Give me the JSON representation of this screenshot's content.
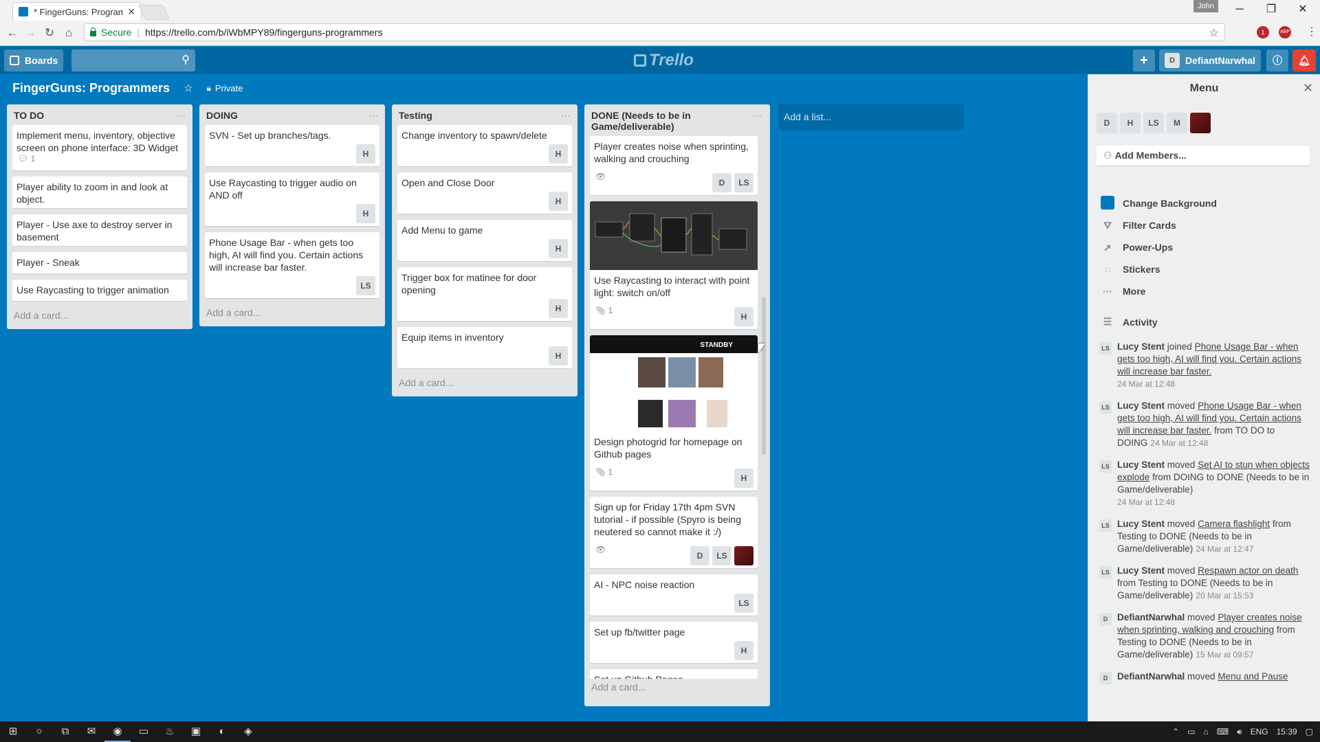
{
  "browser": {
    "tab_title": "* FingerGuns: Programm",
    "user": "John",
    "secure": "Secure",
    "url": "https://trello.com/b/iWbMPY89/fingerguns-programmers",
    "ext1": "1",
    "ext2": "ABP"
  },
  "header": {
    "boards_label": "Boards",
    "logo": "Trello",
    "user_initial": "D",
    "user_name": "DefiantNarwhal"
  },
  "board": {
    "title": "FingerGuns: Programmers",
    "visibility": "Private"
  },
  "lists": [
    {
      "title": "TO DO",
      "cards": [
        {
          "title": "Implement menu, inventory, objective screen on phone interface: 3D Widget",
          "badge": "1"
        },
        {
          "title": "Player ability to zoom in and look at object."
        },
        {
          "title": "Player - Use axe to destroy server in basement"
        },
        {
          "title": "Player - Sneak"
        },
        {
          "title": "Use Raycasting to trigger animation"
        }
      ],
      "add": "Add a card..."
    },
    {
      "title": "DOING",
      "cards": [
        {
          "title": "SVN - Set up branches/tags.",
          "members": [
            "H"
          ]
        },
        {
          "title": "Use Raycasting to trigger audio on AND off",
          "members": [
            "H"
          ]
        },
        {
          "title": "Phone Usage Bar - when gets too high, AI will find you. Certain actions will increase bar faster.",
          "members": [
            "LS"
          ]
        }
      ],
      "add": "Add a card..."
    },
    {
      "title": "Testing",
      "cards": [
        {
          "title": "Change inventory to spawn/delete",
          "members": [
            "H"
          ]
        },
        {
          "title": "Open and Close Door",
          "members": [
            "H"
          ]
        },
        {
          "title": "Add Menu to game",
          "members": [
            "H"
          ]
        },
        {
          "title": "Trigger box for matinee for door opening",
          "members": [
            "H"
          ]
        },
        {
          "title": "Equip items in inventory",
          "members": [
            "H"
          ]
        }
      ],
      "add": "Add a card..."
    },
    {
      "title": "DONE (Needs to be in Game/deliverable)",
      "cards": [
        {
          "title": "Player creates noise when sprinting, walking and crouching",
          "members": [
            "D",
            "LS"
          ]
        },
        {
          "title": "Use Raycasting to interact with point light: switch on/off",
          "badge": "1",
          "members": [
            "H"
          ]
        },
        {
          "title": "Design photogrid for homepage on Github pages",
          "badge": "1",
          "members": [
            "H"
          ],
          "cover_text": "STANDBY"
        },
        {
          "title": "Sign up for Friday 17th 4pm SVN tutorial - if possible (Spyro is being neutered so cannot make it :/)",
          "members": [
            "D",
            "LS"
          ]
        },
        {
          "title": "AI - NPC noise reaction",
          "members": [
            "LS"
          ]
        },
        {
          "title": "Set up fb/twitter page",
          "members": [
            "H"
          ]
        },
        {
          "title": "Set up Github Pages"
        }
      ],
      "add": "Add a card..."
    }
  ],
  "add_list": "Add a list...",
  "menu": {
    "title": "Menu",
    "members": [
      "D",
      "H",
      "LS",
      "M"
    ],
    "add_members": "Add Members...",
    "items": [
      "Change Background",
      "Filter Cards",
      "Power-Ups",
      "Stickers",
      "More"
    ],
    "activity_title": "Activity",
    "activity": [
      {
        "av": "LS",
        "who": "Lucy Stent",
        "verb": "joined",
        "link": "Phone Usage Bar - when gets too high, AI will find you. Certain actions will increase bar faster.",
        "rest": "",
        "when": "24 Mar at 12:48"
      },
      {
        "av": "LS",
        "who": "Lucy Stent",
        "verb": "moved",
        "link": "Phone Usage Bar - when gets too high, AI will find you. Certain actions will increase bar faster.",
        "rest": "from TO DO to DOING",
        "when": "24 Mar at 12:48"
      },
      {
        "av": "LS",
        "who": "Lucy Stent",
        "verb": "moved",
        "link": "Set AI to stun when objects explode",
        "rest": "from DOING to DONE (Needs to be in Game/deliverable)",
        "when": "24 Mar at 12:48"
      },
      {
        "av": "LS",
        "who": "Lucy Stent",
        "verb": "moved",
        "link": "Camera flashlight",
        "rest": "from Testing to DONE (Needs to be in Game/deliverable)",
        "when": "24 Mar at 12:47"
      },
      {
        "av": "LS",
        "who": "Lucy Stent",
        "verb": "moved",
        "link": "Respawn actor on death",
        "rest": "from Testing to DONE (Needs to be in Game/deliverable)",
        "when": "20 Mar at 15:53"
      },
      {
        "av": "D",
        "who": "DefiantNarwhal",
        "verb": "moved",
        "link": "Player creates noise when sprinting, walking and crouching",
        "rest": "from Testing to DONE (Needs to be in Game/deliverable)",
        "when": "15 Mar at 09:57"
      },
      {
        "av": "D",
        "who": "DefiantNarwhal",
        "verb": "moved",
        "link": "Menu and Pause",
        "rest": "",
        "when": ""
      }
    ]
  },
  "taskbar": {
    "lang": "ENG",
    "time": "15:39"
  }
}
